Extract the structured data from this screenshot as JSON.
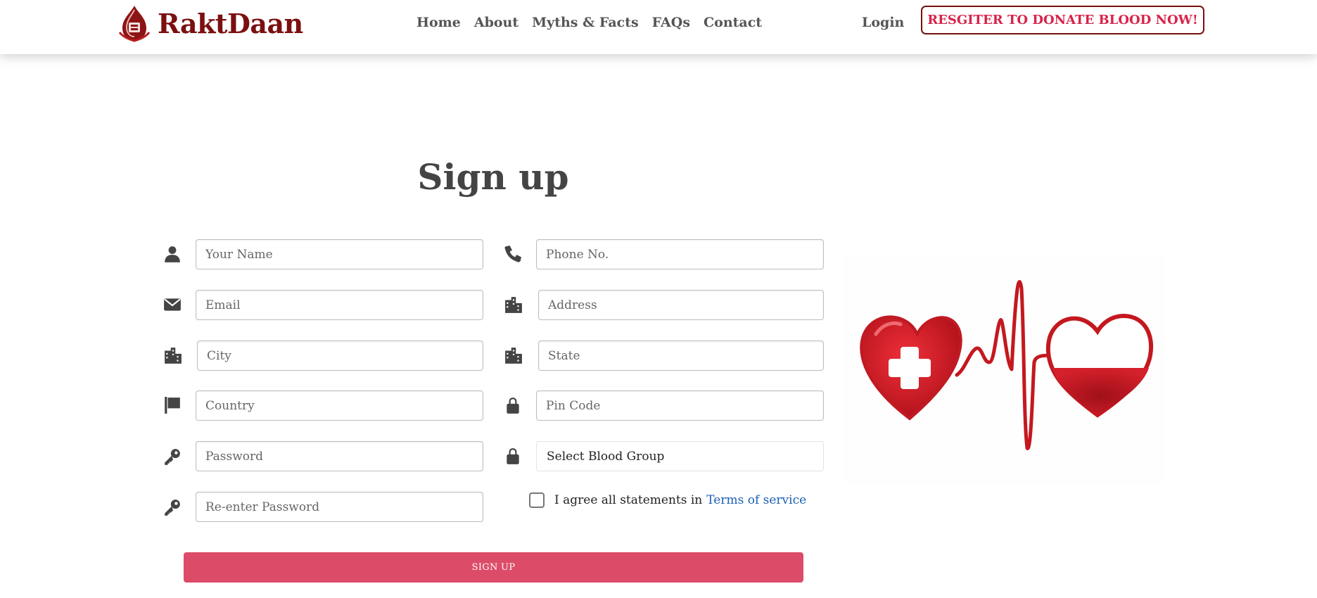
{
  "header": {
    "brand": "RaktDaan",
    "nav": [
      "Home",
      "About",
      "Myths & Facts",
      "FAQs",
      "Contact"
    ],
    "login": "Login",
    "register": "RESGITER TO DONATE BLOOD NOW!"
  },
  "form": {
    "title": "Sign up",
    "fields": {
      "name": "Your Name",
      "phone": "Phone No.",
      "email": "Email",
      "address": "Address",
      "city": "City",
      "state": "State",
      "country": "Country",
      "pincode": "Pin Code",
      "password": "Password",
      "blood_group": "Select Blood Group",
      "reenter": "Re-enter Password"
    },
    "terms_text": "I agree all statements in",
    "terms_link": "Terms of service",
    "submit": "SIGN UP"
  },
  "icons": {
    "name": "user-icon",
    "phone": "phone-icon",
    "email": "envelope-icon",
    "address": "building-icon",
    "city": "building-icon",
    "state": "building-icon",
    "country": "flag-icon",
    "pincode": "lock-icon",
    "password": "key-icon",
    "blood_group": "lock-icon",
    "reenter": "key-icon"
  },
  "colors": {
    "brand": "#7a1010",
    "accent": "#d8234a",
    "button": "#dc4c68",
    "link": "#1a5fb4"
  }
}
